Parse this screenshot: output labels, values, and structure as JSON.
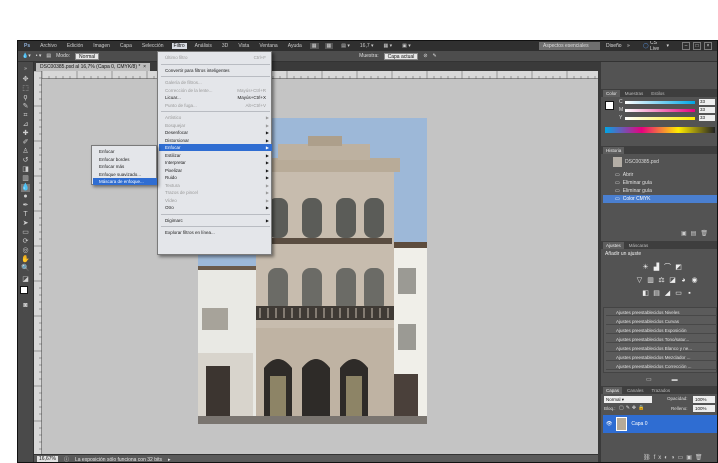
{
  "menubar": {
    "items": [
      "Archivo",
      "Edición",
      "Imagen",
      "Capa",
      "Selección",
      "Filtro",
      "Análisis",
      "3D",
      "Vista",
      "Ventana",
      "Ayuda"
    ],
    "zoom": "16,7",
    "workspace_active": "Aspectos esenciales",
    "workspace_2": "Diseño",
    "cs_live": "CS Live"
  },
  "options": {
    "mode_label": "Modo:",
    "mode_value": "Normal",
    "sample_label": "Muestra:",
    "sample_value": "Capa actual"
  },
  "document": {
    "tab_title": "DSC00385.psd al 16,7% (Capa 0, CMYK/8) *"
  },
  "filter_menu": {
    "items": [
      {
        "label": "Último filtro",
        "shortcut": "Ctrl+F",
        "disabled": true
      },
      {
        "sep": true
      },
      {
        "label": "Convertir para filtros inteligentes"
      },
      {
        "sep": true
      },
      {
        "label": "Galería de filtros...",
        "disabled": true
      },
      {
        "label": "Corrección de la lente...",
        "shortcut": "Mayús+Ctrl+R",
        "disabled": true
      },
      {
        "label": "Licuar...",
        "shortcut": "Mayús+Ctrl+X"
      },
      {
        "label": "Punto de fuga...",
        "shortcut": "Alt+Ctrl+V",
        "disabled": true
      },
      {
        "sep": true
      },
      {
        "label": "Artístico",
        "sub": true,
        "disabled": true
      },
      {
        "label": "Bosquejar",
        "sub": true,
        "disabled": true
      },
      {
        "label": "Desenfocar",
        "sub": true
      },
      {
        "label": "Distorsionar",
        "sub": true
      },
      {
        "label": "Enfocar",
        "sub": true,
        "highlight": true
      },
      {
        "label": "Estilizar",
        "sub": true
      },
      {
        "label": "Interpretar",
        "sub": true
      },
      {
        "label": "Pixelizar",
        "sub": true
      },
      {
        "label": "Ruido",
        "sub": true
      },
      {
        "label": "Textura",
        "sub": true,
        "disabled": true
      },
      {
        "label": "Trazos de pincel",
        "sub": true,
        "disabled": true
      },
      {
        "label": "Vídeo",
        "sub": true,
        "disabled": true
      },
      {
        "label": "Otro",
        "sub": true
      },
      {
        "sep": true
      },
      {
        "label": "Digimarc",
        "sub": true
      },
      {
        "sep": true
      },
      {
        "label": "Explorar filtros en línea..."
      }
    ]
  },
  "enfocar_submenu": {
    "items": [
      {
        "label": "Enfocar"
      },
      {
        "label": "Enfocar bordes"
      },
      {
        "label": "Enfocar más"
      },
      {
        "label": "Enfoque suavizado..."
      },
      {
        "label": "Máscara de enfoque...",
        "highlight": true
      }
    ]
  },
  "color_panel": {
    "tabs": [
      "Color",
      "Muestras",
      "Estilos"
    ],
    "c_label": "C",
    "c_value": "33",
    "m_label": "M",
    "m_value": "33",
    "y_label": "Y",
    "y_value": "33"
  },
  "history_panel": {
    "tabs": [
      "Historia"
    ],
    "snapshot": "DSC00385.psd",
    "items": [
      "Abrir",
      "Eliminar guía",
      "Eliminar guía",
      "Color CMYK"
    ]
  },
  "adjust_panel": {
    "tabs": [
      "Ajustes",
      "Máscaras"
    ],
    "heading": "Añadir un ajuste",
    "presets": [
      "Ajustes preestablecidos Niveles",
      "Ajustes preestablecidos Curvas",
      "Ajustes preestablecidos Exposición",
      "Ajustes preestablecidos Tono/satur...",
      "Ajustes preestablecidos Blanco y ne...",
      "Ajustes preestablecidos Mezclador ...",
      "Ajustes preestablecidos Corrección ..."
    ]
  },
  "layers_panel": {
    "tabs": [
      "Capas",
      "Canales",
      "Trazados"
    ],
    "blend": "Normal",
    "opacity_label": "Opacidad:",
    "opacity_value": "100%",
    "lock_label": "Bloq.:",
    "fill_label": "Relleno:",
    "fill_value": "100%",
    "layer_name": "Capa 0"
  },
  "status": {
    "zoom": "16,67%",
    "message": "La exposición sólo funciona con 32 bits"
  }
}
